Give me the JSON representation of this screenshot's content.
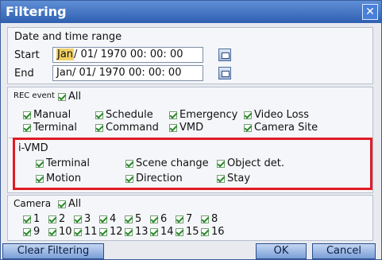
{
  "window": {
    "title": "Filtering",
    "close": "✕"
  },
  "date_range": {
    "heading": "Date and time range",
    "start_label": "Start",
    "start_month": "Jan",
    "start_rest": "/ 01/ 1970 00: 00: 00",
    "end_label": "End",
    "end_value": "Jan/ 01/ 1970 00: 00: 00"
  },
  "rec_event": {
    "label": "REC event",
    "all": "All",
    "items": [
      "Manual",
      "Schedule",
      "Emergency",
      "Video Loss",
      "Terminal",
      "Command",
      "VMD",
      "Camera Site"
    ]
  },
  "ivmd": {
    "label": "i-VMD",
    "items": [
      "Terminal",
      "Scene change",
      "Object det.",
      "Motion",
      "Direction",
      "Stay"
    ]
  },
  "camera": {
    "label": "Camera",
    "all": "All",
    "items": [
      "1",
      "2",
      "3",
      "4",
      "5",
      "6",
      "7",
      "8",
      "9",
      "10",
      "11",
      "12",
      "13",
      "14",
      "15",
      "16"
    ]
  },
  "buttons": {
    "clear": "Clear Filtering",
    "ok": "OK",
    "cancel": "Cancel"
  },
  "colors": {
    "title_bar": "#3f6fc2",
    "highlight": "#e01b24",
    "check": "#2b8a2b"
  }
}
